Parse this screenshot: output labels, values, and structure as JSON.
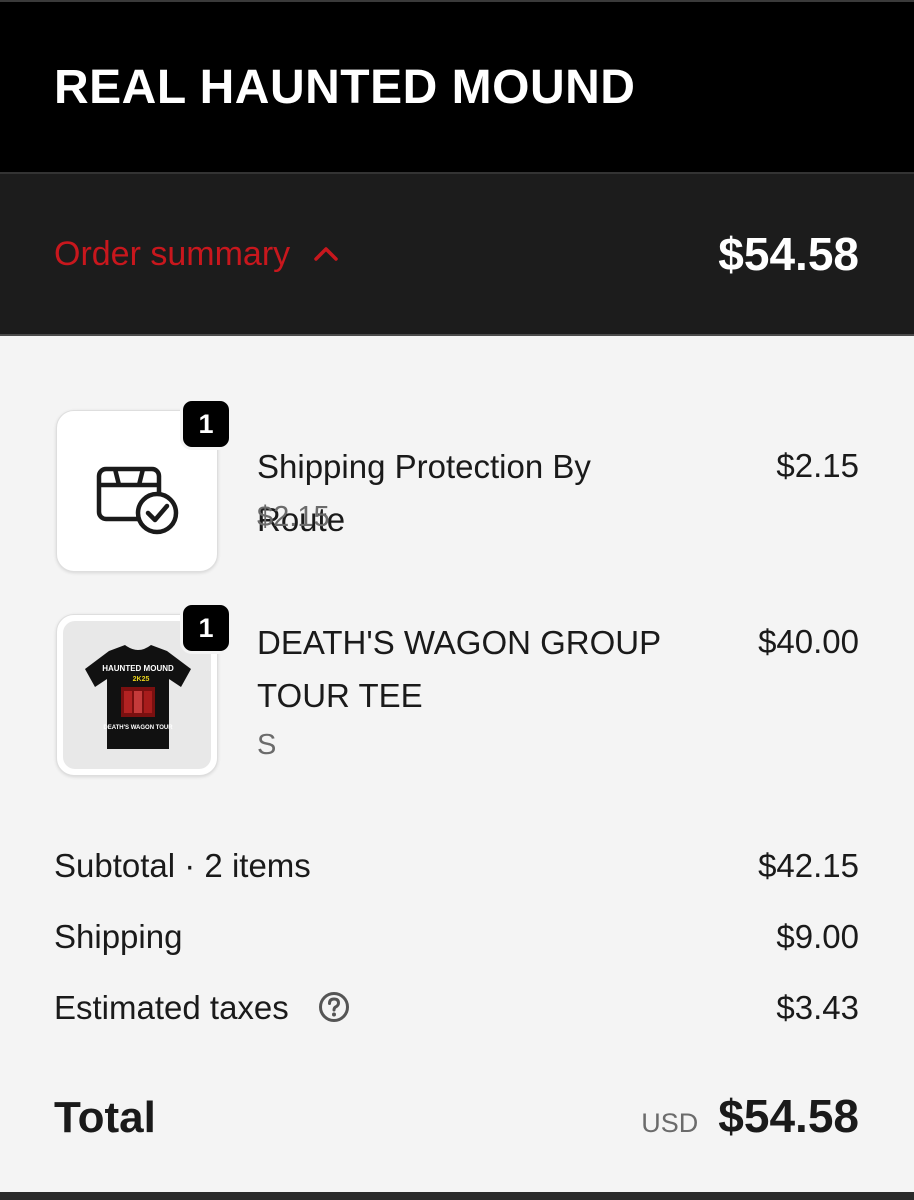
{
  "header": {
    "store_name": "REAL HAUNTED MOUND"
  },
  "summary_bar": {
    "label": "Order summary",
    "toggle_icon": "chevron-up-icon",
    "total": "$54.58",
    "accent_color": "#c8171d"
  },
  "items": [
    {
      "name": "Shipping Protection By Route",
      "subtitle": "$2.15",
      "price": "$2.15",
      "quantity": "1",
      "thumbnail_icon": "package-check-icon"
    },
    {
      "name": "DEATH'S WAGON GROUP TOUR TEE",
      "subtitle": "S",
      "price": "$40.00",
      "quantity": "1",
      "thumbnail": {
        "shirt_title": "HAUNTED MOUND",
        "shirt_year": "2K25",
        "shirt_caption": "DEATH'S WAGON TOUR"
      }
    }
  ],
  "costs": {
    "subtotal_label": "Subtotal · 2 items",
    "subtotal_value": "$42.15",
    "shipping_label": "Shipping",
    "shipping_value": "$9.00",
    "taxes_label": "Estimated taxes",
    "taxes_help_icon": "question-circle-icon",
    "taxes_value": "$3.43"
  },
  "total": {
    "label": "Total",
    "currency": "USD",
    "amount": "$54.58"
  }
}
